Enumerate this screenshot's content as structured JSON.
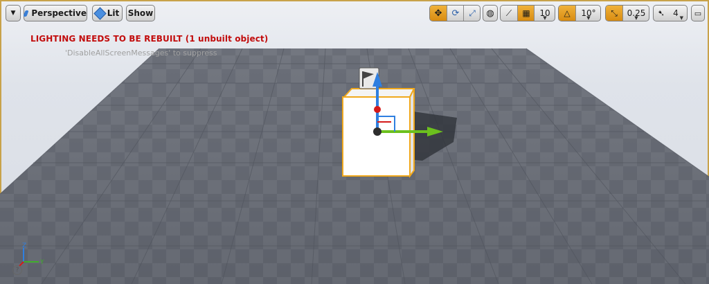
{
  "toolbar": {
    "menu_icon": "chevron-down-icon",
    "perspective_label": "Perspective",
    "lit_label": "Lit",
    "show_label": "Show",
    "grid_snap_value": "10",
    "rotation_snap_value": "10°",
    "scale_snap_value": "0.25",
    "camera_speed_value": "4"
  },
  "messages": {
    "warning": "LIGHTING NEEDS TO BE REBUILT (1 unbuilt object)",
    "hint": "'DisableAllScreenMessages' to suppress"
  },
  "axis_indicator": {
    "z": "Z",
    "y": "Y"
  },
  "help": "?",
  "colors": {
    "accent": "#e69a1c",
    "warning": "#c20d0d",
    "selection": "#f0a81c",
    "gizmo_x_red": "#d51a1a",
    "gizmo_y_green": "#6cc01e",
    "gizmo_z_blue": "#2f7fe0"
  }
}
